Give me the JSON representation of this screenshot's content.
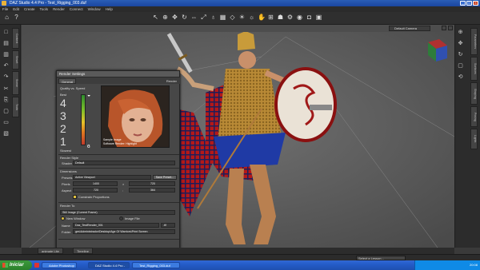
{
  "window": {
    "title": "DAZ Studio 4.4 Pro - Test_Rigging_003.duf"
  },
  "menu": [
    "File",
    "Edit",
    "Create",
    "Tools",
    "Render",
    "Connect",
    "Window",
    "Help"
  ],
  "viewport": {
    "camera": "Default Camera"
  },
  "render_settings": {
    "title": "Render Settings",
    "tab_general": "General",
    "tab_render": "Render",
    "quality_label": "Quality vs. Speed",
    "quality_levels": [
      "4",
      "3",
      "2",
      "1"
    ],
    "quality_top": "Best",
    "quality_bottom": "Slowest",
    "preview_caption_1": "Sample Image",
    "preview_caption_2": "Software Render: Highlight",
    "render_style_label": "Render Style",
    "shader_label": "Shader",
    "shader_value": "Default",
    "dimensions_label": "Dimensions",
    "preset_label": "Presets",
    "preset_value": "Active Viewport",
    "save_preset": "Save Preset...",
    "pixels_label": "Pixels",
    "width": "1400",
    "height": "720",
    "aspect_label": "Aspect",
    "aspect_w": "720",
    "aspect_h": "364",
    "constrain_label": "Constrain Proportions",
    "render_to_label": "Render To",
    "render_to_value": "Still Image (Current Frame)",
    "new_window": "New Window",
    "image_file": "Image File",
    "name_label": "Name",
    "name_value": "Daz_TestRender_001",
    "ext_value": ".tif",
    "folder_label": "Folder",
    "folder_value": "ges\\Administrador\\Desktop\\Age Of Warriors\\Print Screen"
  },
  "bottom_tabs": [
    "animate Lite",
    "Timeline"
  ],
  "lesson": "Select a Lesson...",
  "taskbar": {
    "start": "Iniciar",
    "tasks": [
      "Adobe Photoshop",
      "DAZ Studio 4.4 Pro -",
      "Test_Rigging_003.duf"
    ],
    "clock": "20:08"
  },
  "colors": {
    "accent": "#e0c040",
    "quality_top": "#2e8b2e",
    "quality_bottom": "#c0392b"
  }
}
